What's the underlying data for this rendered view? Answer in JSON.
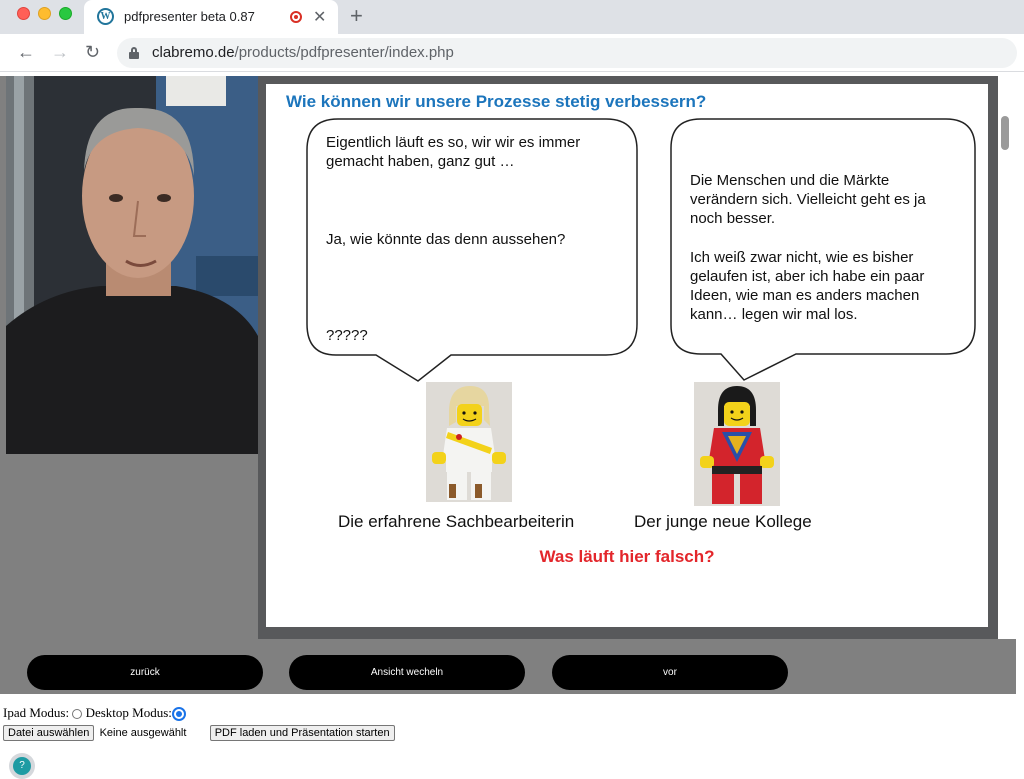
{
  "browser": {
    "tab_title": "pdfpresenter beta 0.87",
    "tab_close": "✕",
    "new_tab": "+",
    "url_domain": "clabremo.de",
    "url_path": "/products/pdfpresenter/index.php",
    "back": "←",
    "forward": "→",
    "reload": "↻"
  },
  "slide": {
    "title": "Wie können wir unsere Prozesse stetig verbessern?",
    "left_bubble": {
      "line1": "Eigentlich läuft es so, wir wir es immer",
      "line2": "gemacht haben, ganz gut …",
      "line3": "Ja, wie könnte das denn aussehen?",
      "line4": "?????"
    },
    "right_bubble": {
      "line1": "Die Menschen und die Märkte",
      "line2": "verändern sich. Vielleicht geht es ja",
      "line3": "noch besser.",
      "line4": "Ich weiß zwar nicht, wie es bisher",
      "line5": "gelaufen ist, aber ich habe ein paar",
      "line6": "Ideen, wie man es anders machen",
      "line7": "kann… legen wir mal los."
    },
    "left_caption": "Die erfahrene Sachbearbeiterin",
    "right_caption": "Der junge neue Kollege",
    "question": "Was läuft hier falsch?"
  },
  "controls": {
    "back": "zurück",
    "switch_view": "Ansicht wecheln",
    "next": "vor"
  },
  "footer": {
    "ipad_mode": "Ipad Modus:",
    "desktop_mode": "Desktop Modus:",
    "choose_file": "Datei auswählen",
    "no_file": "Keine ausgewählt",
    "load_pdf": "PDF laden und Präsentation starten",
    "help": "?"
  }
}
